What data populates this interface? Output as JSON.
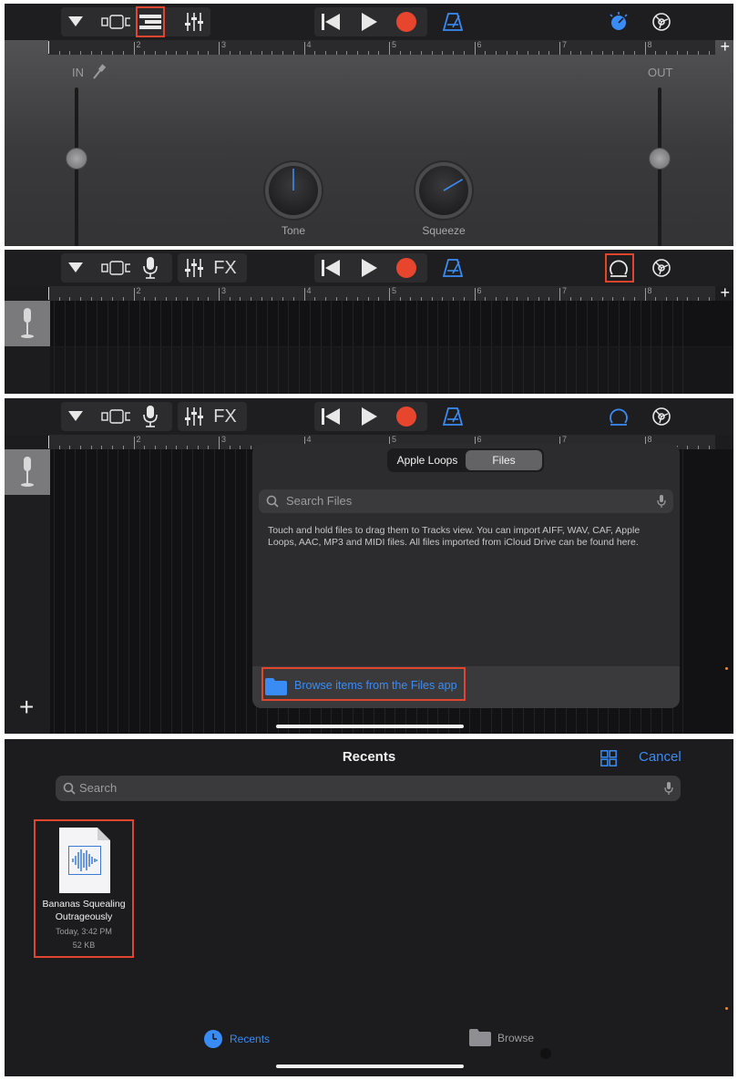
{
  "ruler_numbers": [
    "2",
    "3",
    "4",
    "5",
    "6",
    "7",
    "8"
  ],
  "add_track_symbol": "+",
  "panel1": {
    "in_label": "IN",
    "out_label": "OUT",
    "knobs": [
      {
        "label": "Tone",
        "value": 0.5
      },
      {
        "label": "Squeeze",
        "value": 0.72
      }
    ],
    "in_level": 0.45,
    "out_level": 0.45
  },
  "toolbar": {
    "fx_label": "FX"
  },
  "files_browser": {
    "tabs": [
      "Apple Loops",
      "Files"
    ],
    "selected_tab": "Files",
    "search_placeholder": "Search Files",
    "info_text": "Touch and hold files to drag them to Tracks view. You can import AIFF, WAV, CAF, Apple Loops, AAC, MP3 and MIDI files. All files imported from iCloud Drive can be found here.",
    "browse_label": "Browse items from the Files app",
    "add_button": "+"
  },
  "recents": {
    "title": "Recents",
    "cancel_label": "Cancel",
    "search_placeholder": "Search",
    "file": {
      "name_line1": "Bananas Squealing",
      "name_line2": "Outrageously",
      "date": "Today, 3:42 PM",
      "size": "52 KB"
    },
    "tabs": [
      {
        "label": "Recents",
        "icon": "clock-icon",
        "active": true
      },
      {
        "label": "Browse",
        "icon": "folder-icon",
        "active": false
      }
    ]
  },
  "colors": {
    "accent_blue": "#3a8cf5",
    "record_red": "#e8452f",
    "highlight_box": "#e0452e"
  }
}
